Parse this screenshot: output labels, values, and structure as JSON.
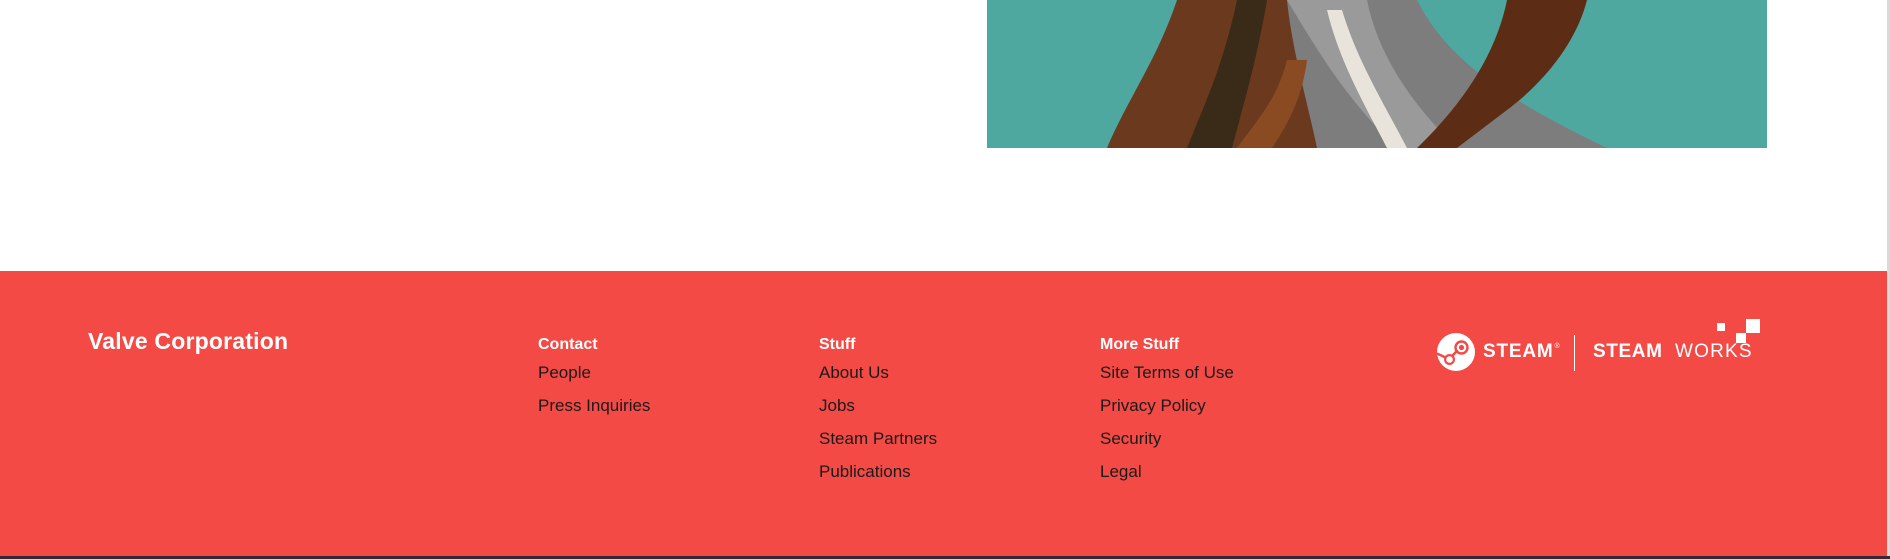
{
  "footer": {
    "brand": "Valve Corporation",
    "columns": [
      {
        "heading": "Contact",
        "links": [
          "People",
          "Press Inquiries"
        ]
      },
      {
        "heading": "Stuff",
        "links": [
          "About Us",
          "Jobs",
          "Steam Partners",
          "Publications"
        ]
      },
      {
        "heading": "More Stuff",
        "links": [
          "Site Terms of Use",
          "Privacy Policy",
          "Security",
          "Legal"
        ]
      }
    ],
    "logos": {
      "steam_label": "STEAM",
      "steam_reg": "®",
      "steamworks_bold": "STEAM",
      "steamworks_light": "WORKS"
    }
  },
  "colors": {
    "footer_background": "#f44a46",
    "footer_heading": "#ffffff",
    "footer_link": "#1a1a1a",
    "hero_teal": "#4fa8a0"
  },
  "icons": {
    "steam": "steam-logo-icon",
    "steamworks": "steamworks-squares-icon"
  }
}
